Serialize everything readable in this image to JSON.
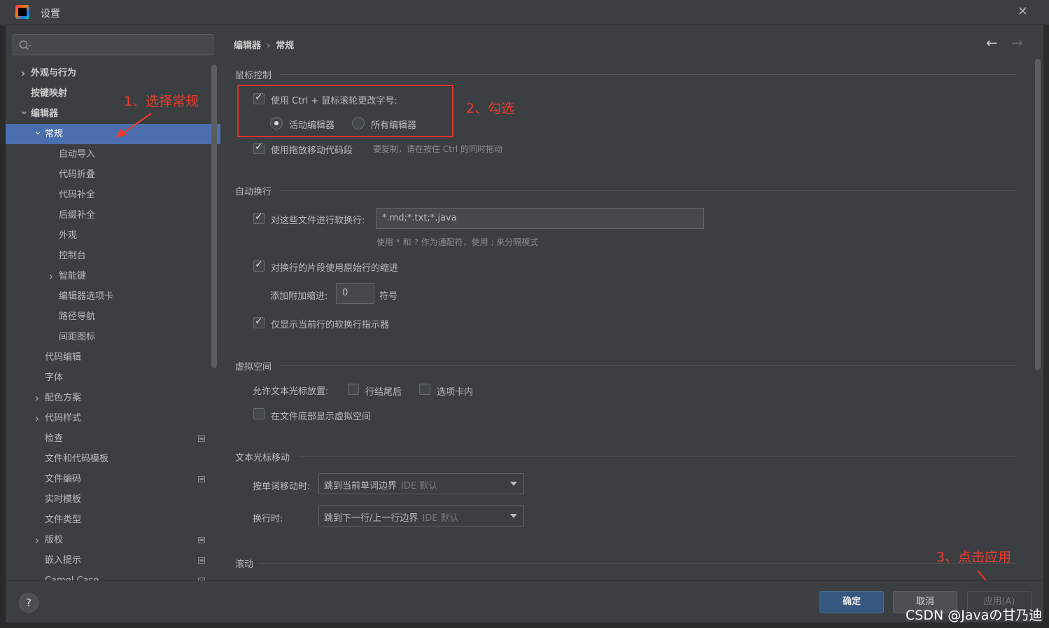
{
  "window": {
    "title": "设置"
  },
  "search": {
    "placeholder": ""
  },
  "sidebar": {
    "items": [
      {
        "label": "外观与行为",
        "level": 0,
        "chevron": "right",
        "bold": true
      },
      {
        "label": "按键映射",
        "level": 0,
        "chevron": "",
        "bold": true
      },
      {
        "label": "编辑器",
        "level": 0,
        "chevron": "down",
        "bold": true
      },
      {
        "label": "常规",
        "level": 1,
        "chevron": "down",
        "selected": true
      },
      {
        "label": "自动导入",
        "level": 2,
        "chevron": ""
      },
      {
        "label": "代码折叠",
        "level": 2,
        "chevron": ""
      },
      {
        "label": "代码补全",
        "level": 2,
        "chevron": ""
      },
      {
        "label": "后缀补全",
        "level": 2,
        "chevron": ""
      },
      {
        "label": "外观",
        "level": 2,
        "chevron": ""
      },
      {
        "label": "控制台",
        "level": 2,
        "chevron": ""
      },
      {
        "label": "智能键",
        "level": 2,
        "chevron": "right"
      },
      {
        "label": "编辑器选项卡",
        "level": 2,
        "chevron": ""
      },
      {
        "label": "路径导航",
        "level": 2,
        "chevron": ""
      },
      {
        "label": "间距图标",
        "level": 2,
        "chevron": ""
      },
      {
        "label": "代码编辑",
        "level": 1,
        "chevron": ""
      },
      {
        "label": "字体",
        "level": 1,
        "chevron": ""
      },
      {
        "label": "配色方案",
        "level": 1,
        "chevron": "right"
      },
      {
        "label": "代码样式",
        "level": 1,
        "chevron": "right"
      },
      {
        "label": "检查",
        "level": 1,
        "chevron": "",
        "badge": true
      },
      {
        "label": "文件和代码模板",
        "level": 1,
        "chevron": ""
      },
      {
        "label": "文件编码",
        "level": 1,
        "chevron": "",
        "badge": true
      },
      {
        "label": "实时模板",
        "level": 1,
        "chevron": ""
      },
      {
        "label": "文件类型",
        "level": 1,
        "chevron": ""
      },
      {
        "label": "版权",
        "level": 1,
        "chevron": "right",
        "badge": true
      },
      {
        "label": "嵌入提示",
        "level": 1,
        "chevron": "",
        "badge": true
      },
      {
        "label": "Camel Case",
        "level": 1,
        "chevron": "",
        "badge": true
      }
    ]
  },
  "breadcrumb": {
    "parent": "编辑器",
    "current": "常规"
  },
  "mouse_control": {
    "section": "鼠标控制",
    "ctrl_wheel_label": "使用 Ctrl + 鼠标滚轮更改字号:",
    "ctrl_wheel_checked": true,
    "radio_active": "活动编辑器",
    "radio_all": "所有编辑器",
    "radio_selected": "活动编辑器",
    "drag_move_label": "使用拖放移动代码段",
    "drag_move_checked": true,
    "drag_move_hint": "要复制，请在按住 Ctrl 的同时拖动"
  },
  "soft_wrap": {
    "section": "自动换行",
    "files_label": "对这些文件进行软换行:",
    "files_checked": true,
    "files_value": "*.md;*.txt;*.java",
    "files_hint": "使用 * 和 ? 作为通配符，使用 ; 来分隔模式",
    "indent_label": "对换行的片段使用原始行的缩进",
    "indent_checked": true,
    "extra_indent_label": "添加附加缩进:",
    "extra_indent_value": "0",
    "extra_indent_unit": "符号",
    "current_line_label": "仅显示当前行的软换行指示器",
    "current_line_checked": true
  },
  "virtual_space": {
    "section": "虚拟空间",
    "caret_label": "允许文本光标放置:",
    "after_eol": "行结尾后",
    "inside_tabs": "选项卡内",
    "bottom_label": "在文件底部显示虚拟空间"
  },
  "caret_movement": {
    "section": "文本光标移动",
    "word_label": "按单词移动时:",
    "word_value": "跳到当前单词边界",
    "word_default": "IDE 默认",
    "line_label": "换行时:",
    "line_value": "跳到下一行/上一行边界",
    "line_default": "IDE 默认"
  },
  "scrolling": {
    "section": "滚动"
  },
  "annotations": {
    "step1": "1、选择常规",
    "step2": "2、勾选",
    "step3": "3、点击应用",
    "color": "#ee3b2e"
  },
  "footer": {
    "help": "?",
    "ok": "确定",
    "cancel": "取消",
    "apply": "应用(A)"
  },
  "watermark": "CSDN @Javaの甘乃迪",
  "colors": {
    "selection": "#4b6eaf",
    "panel": "#3c3f41",
    "ok_button": "#365880"
  }
}
